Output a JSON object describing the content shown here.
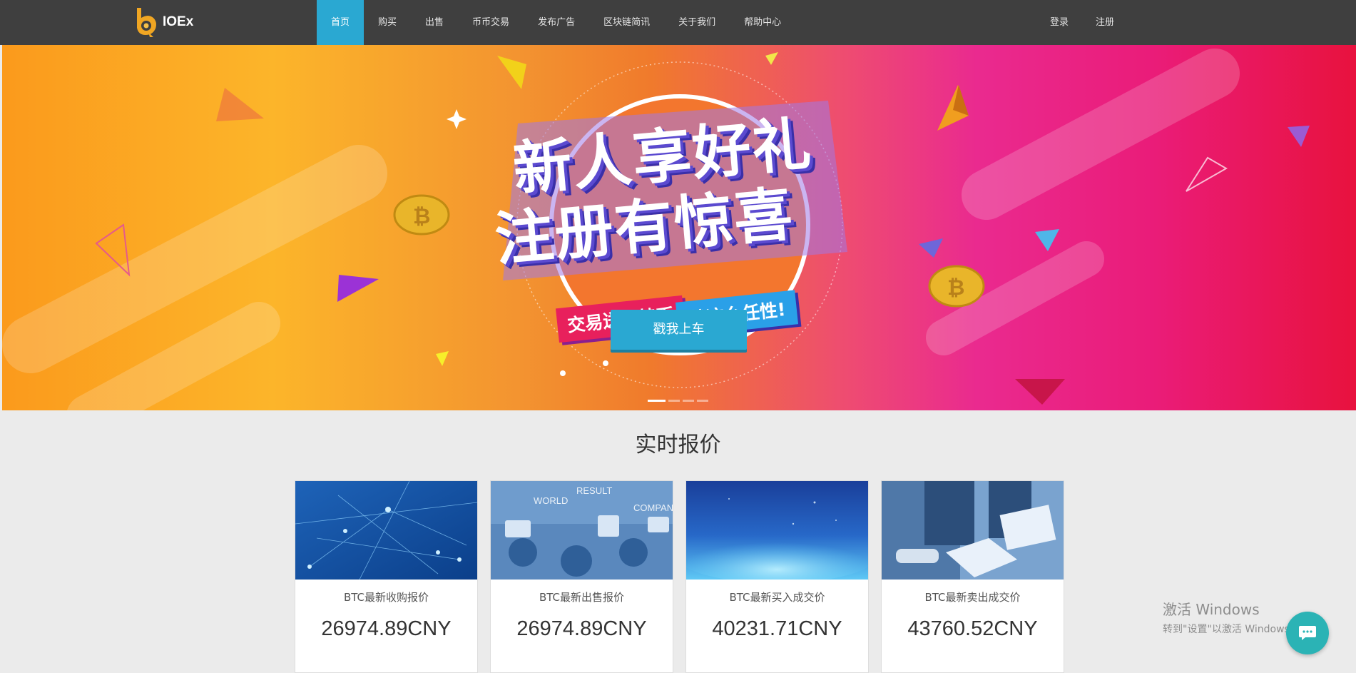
{
  "header": {
    "brand": "IOEx",
    "nav": [
      "首页",
      "购买",
      "出售",
      "币币交易",
      "发布广告",
      "区块链简讯",
      "关于我们",
      "帮助中心"
    ],
    "active_nav": "首页",
    "auth": {
      "login": "登录",
      "register": "注册"
    }
  },
  "banner": {
    "headline_line1": "新人享好礼",
    "headline_line2": "注册有惊喜",
    "tag_left": "交易送比特币",
    "tag_right": "就这么任性!",
    "cta": "戳我上车",
    "slide_count": 4,
    "active_slide": 1
  },
  "quotes": {
    "title": "实时报价",
    "cards": [
      {
        "label": "BTC最新收购报价",
        "value": "26974.89CNY",
        "image": "network-nodes"
      },
      {
        "label": "BTC最新出售报价",
        "value": "26974.89CNY",
        "image": "people-tablets-world"
      },
      {
        "label": "BTC最新买入成交价",
        "value": "40231.71CNY",
        "image": "blue-horizon-light"
      },
      {
        "label": "BTC最新卖出成交价",
        "value": "43760.52CNY",
        "image": "business-people-documents"
      }
    ]
  },
  "watermark": {
    "title": "激活 Windows",
    "subtitle": "转到\"设置\"以激活 Windows。"
  },
  "chat": {
    "icon": "chat-bubble-icon"
  },
  "colors": {
    "header_bg": "#3f3f3f",
    "accent": "#2aa8d2",
    "page_bg": "#ebebeb",
    "chat": "#2bb3b5"
  }
}
